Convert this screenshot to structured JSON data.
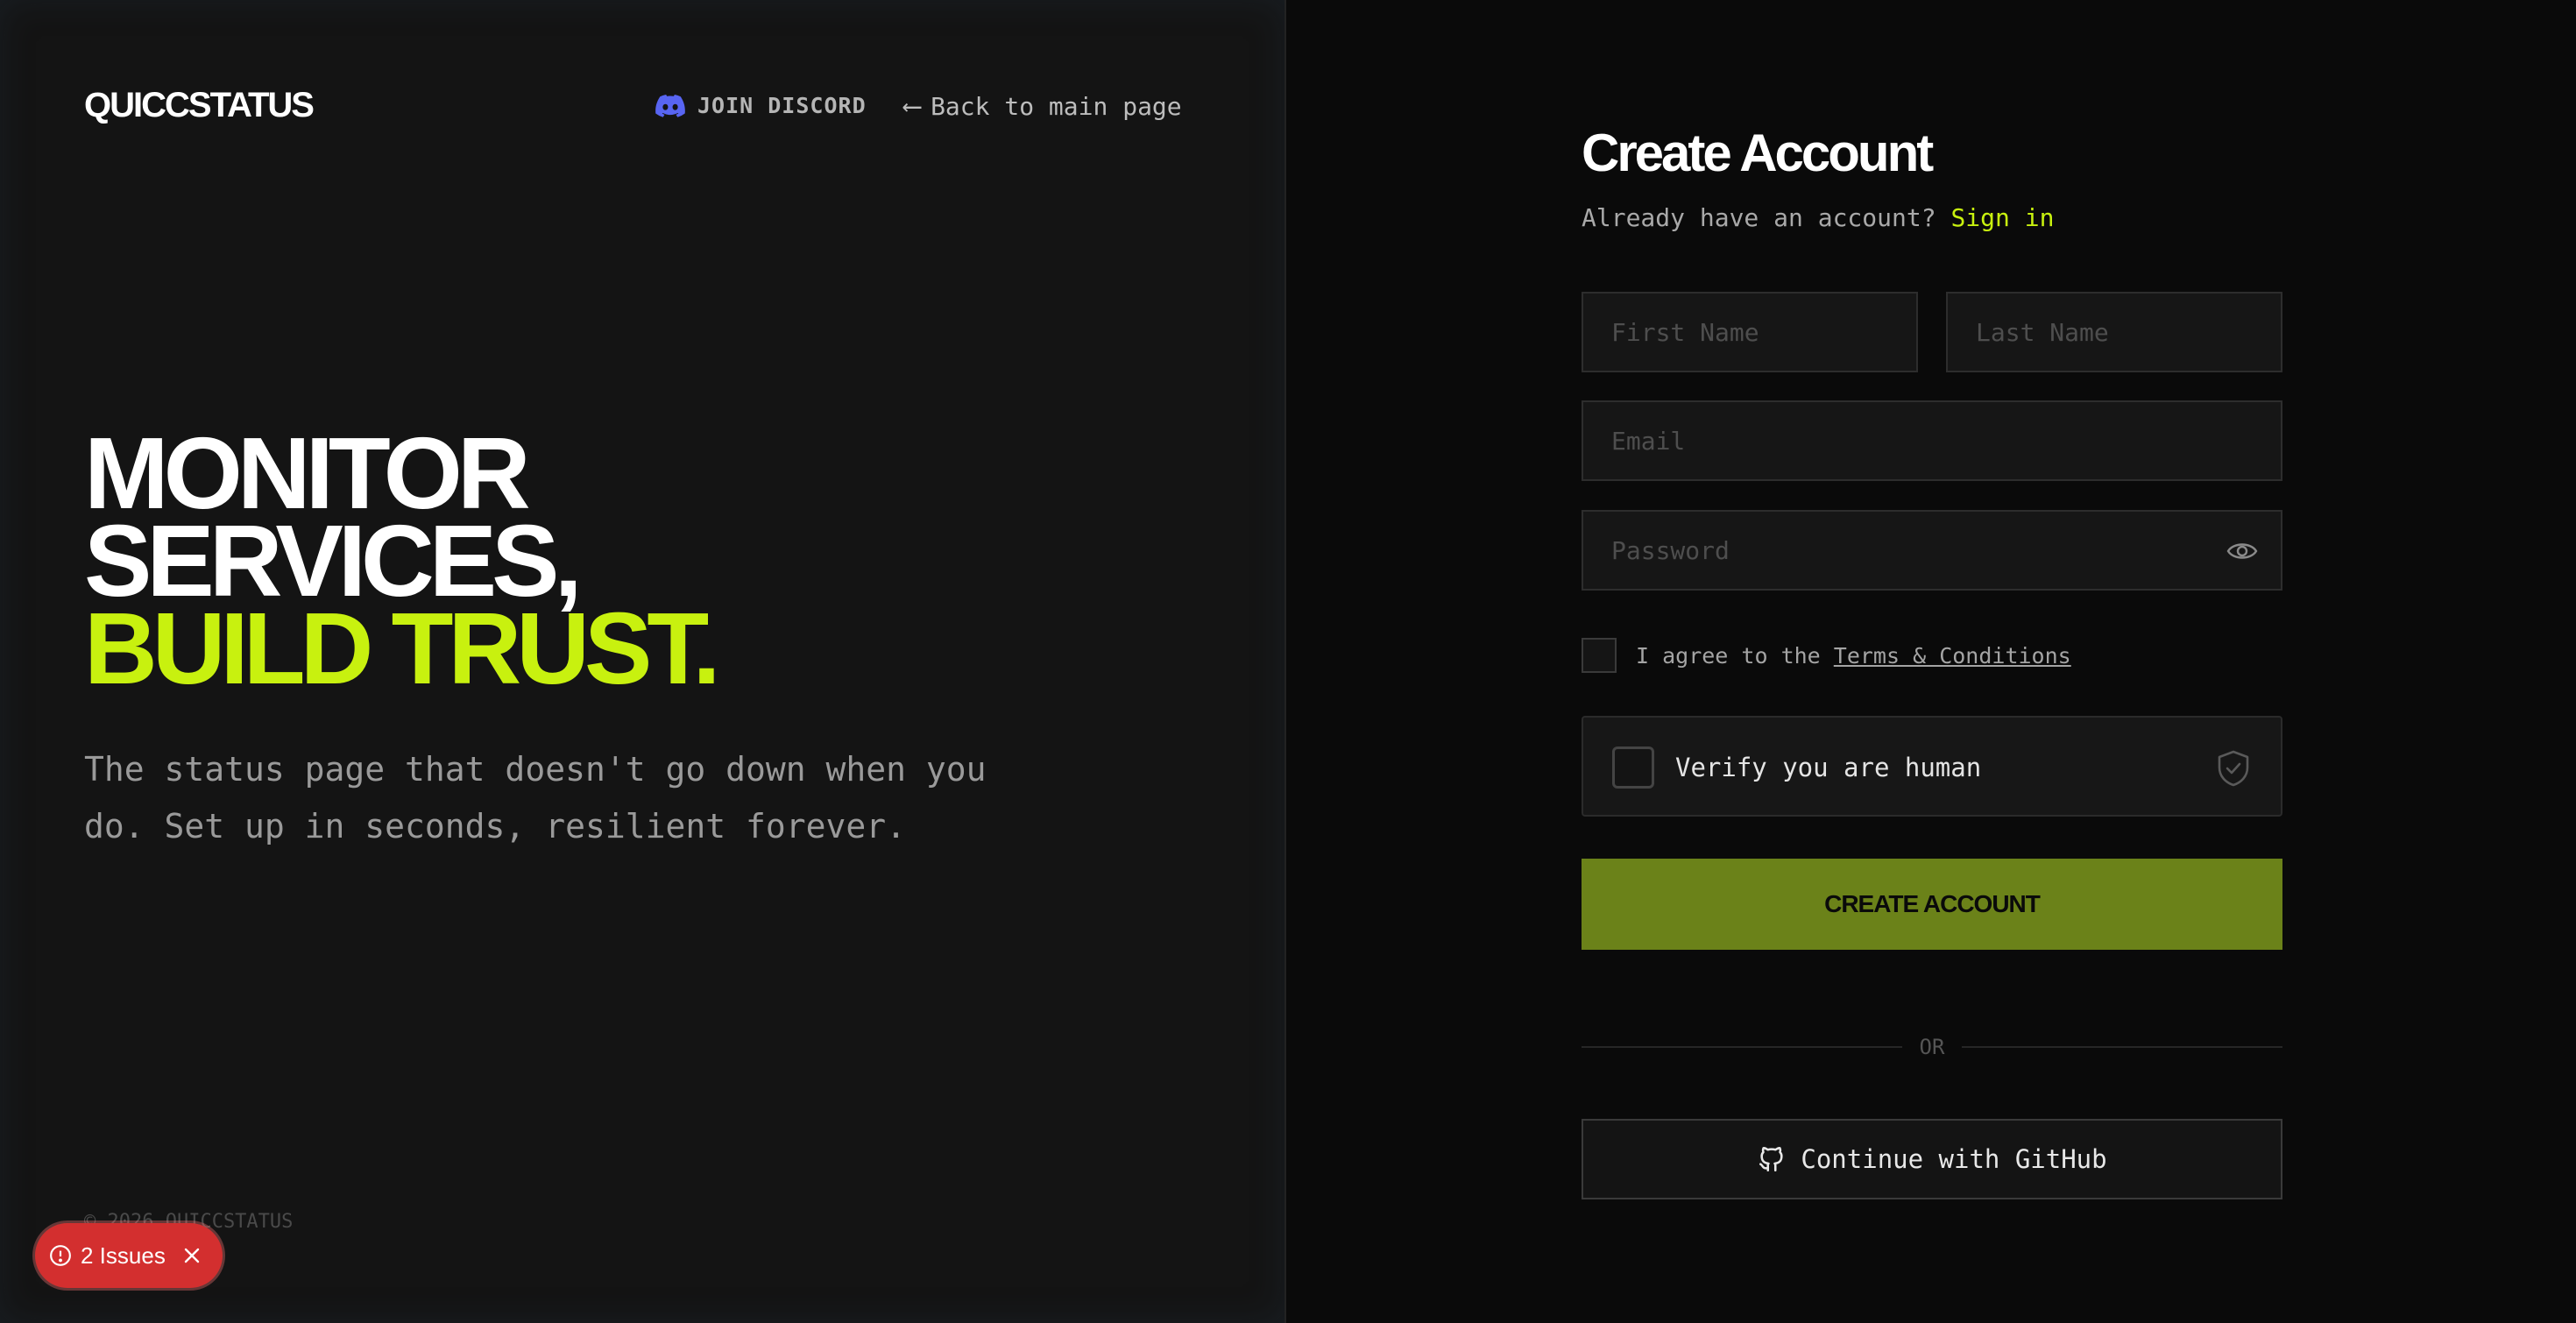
{
  "brand": "QUICCSTATUS",
  "nav": {
    "discord_label": "JOIN DISCORD",
    "back_arrow": "⟵",
    "back_label": "Back to main page"
  },
  "hero": {
    "line1": "MONITOR",
    "line2": "SERVICES,",
    "line3": "BUILD TRUST."
  },
  "subtitle": "The status page that doesn't go down when you do. Set up in seconds, resilient forever.",
  "copyright": "© 2026 QUICCSTATUS",
  "issues_badge": {
    "label": "2 Issues"
  },
  "form": {
    "title": "Create Account",
    "signin_prompt": "Already have an account? ",
    "signin_link": "Sign in",
    "first_name_placeholder": "First Name",
    "last_name_placeholder": "Last Name",
    "email_placeholder": "Email",
    "password_placeholder": "Password",
    "terms_prefix": "I agree to the ",
    "terms_link": "Terms & Conditions",
    "captcha_label": "Verify you are human",
    "create_button": "CREATE ACCOUNT",
    "divider": "OR",
    "github_button": "Continue with GitHub"
  },
  "colors": {
    "accent": "#c8f10f",
    "button_bg": "#6b8219",
    "issues_red": "#d32f2f",
    "discord": "#5865f2"
  },
  "icons": {
    "discord": "discord-icon",
    "eye": "eye-icon",
    "shield": "shield-check-icon",
    "github": "github-icon",
    "alert": "alert-circle-icon",
    "close": "close-icon"
  }
}
